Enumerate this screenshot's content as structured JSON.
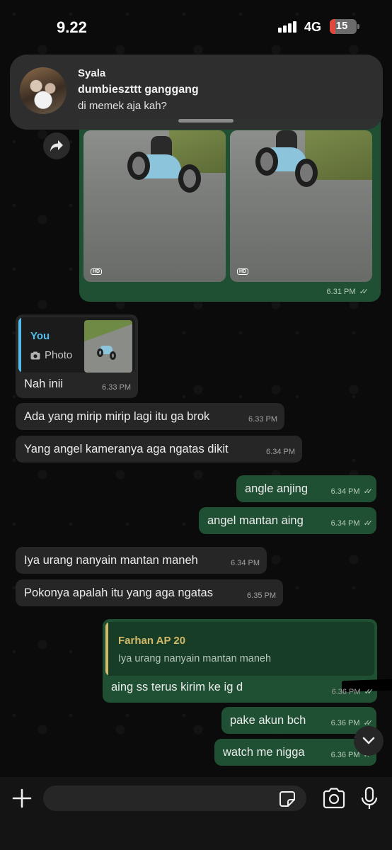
{
  "status_bar": {
    "time": "9.22",
    "network": "4G",
    "battery": "15"
  },
  "notification": {
    "sender": "Syala",
    "group": "dumbieszttt ganggang",
    "message": "di memek aja kah?"
  },
  "image_message": {
    "hd_badge": "HD",
    "time": "6.31 PM"
  },
  "messages": [
    {
      "id": "m1",
      "direction": "in",
      "quote": {
        "author": "You",
        "type_label": "Photo"
      },
      "text": "Nah inii",
      "time": "6.33 PM"
    },
    {
      "id": "m2",
      "direction": "in",
      "text": "Ada yang mirip mirip lagi itu ga brok",
      "time": "6.33 PM"
    },
    {
      "id": "m3",
      "direction": "in",
      "text": "Yang angel kameranya aga ngatas dikit",
      "time": "6.34 PM"
    },
    {
      "id": "m4",
      "direction": "out",
      "text": "angle anjing",
      "time": "6.34 PM"
    },
    {
      "id": "m5",
      "direction": "out",
      "text": "angel mantan aing",
      "time": "6.34 PM"
    },
    {
      "id": "m6",
      "direction": "in",
      "text": "Iya urang nanyain mantan maneh",
      "time": "6.34 PM"
    },
    {
      "id": "m7",
      "direction": "in",
      "text": "Pokonya apalah itu yang aga ngatas",
      "time": "6.35 PM"
    },
    {
      "id": "m8",
      "direction": "out",
      "quote": {
        "author": "Farhan AP 20",
        "text": "Iya urang nanyain mantan maneh"
      },
      "text": "aing ss terus kirim ke ig d",
      "time": "6.36 PM"
    },
    {
      "id": "m9",
      "direction": "out",
      "text": "pake akun bch",
      "time": "6.36 PM"
    },
    {
      "id": "m10",
      "direction": "out",
      "text": "watch me nigga",
      "time": "6.36 PM"
    }
  ],
  "input_bar": {
    "placeholder": ""
  },
  "colors": {
    "outgoing_bubble": "#1f5033",
    "incoming_bubble": "#262626",
    "quote_you": "#53bdeb",
    "quote_farhan": "#d3b96a",
    "background": "#0b0b0b"
  },
  "icons": [
    "forward-icon",
    "hd-badge",
    "camera-small-icon",
    "double-check-icon",
    "chevron-down-icon",
    "plus-icon",
    "sticker-icon",
    "camera-icon",
    "microphone-icon"
  ]
}
